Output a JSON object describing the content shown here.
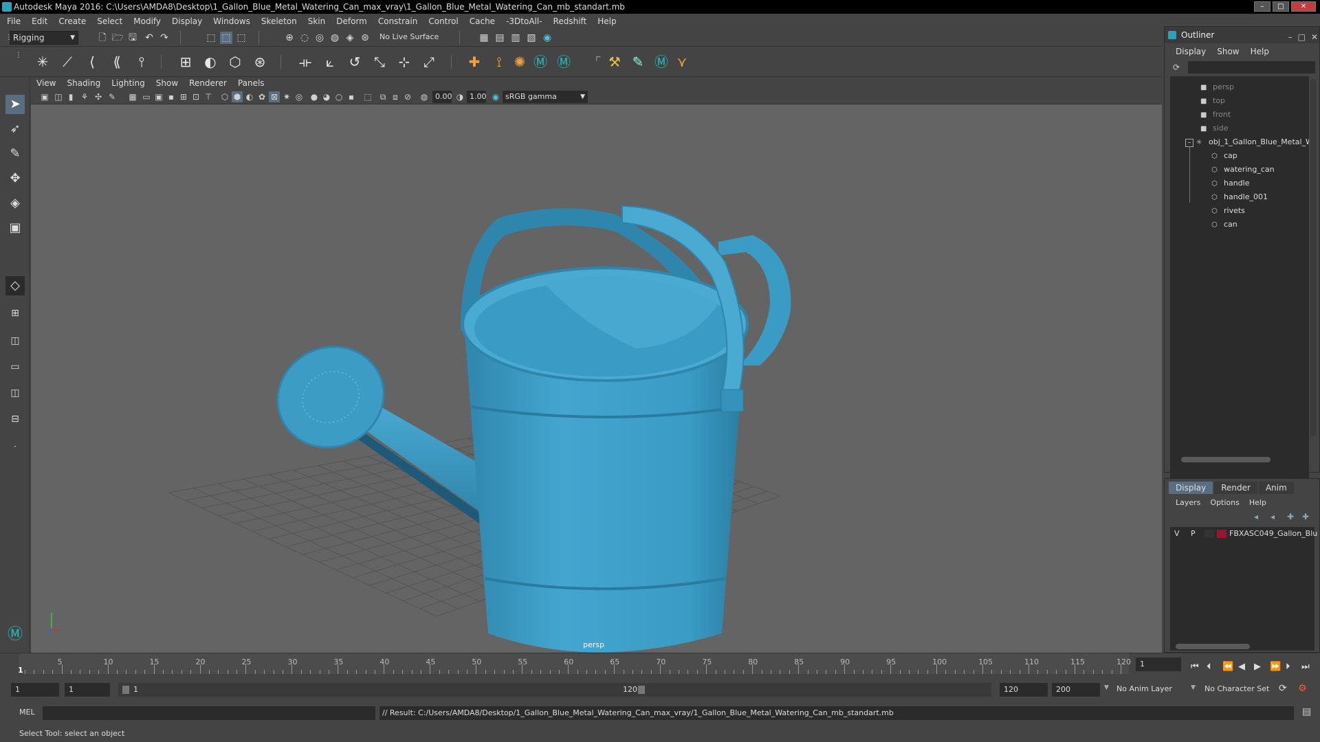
{
  "window": {
    "title": "Autodesk Maya 2016: C:\\Users\\AMDA8\\Desktop\\1_Gallon_Blue_Metal_Watering_Can_max_vray\\1_Gallon_Blue_Metal_Watering_Can_mb_standart.mb",
    "min": "–",
    "max": "□",
    "close": "✕"
  },
  "menu": [
    "File",
    "Edit",
    "Create",
    "Select",
    "Modify",
    "Display",
    "Windows",
    "Skeleton",
    "Skin",
    "Deform",
    "Constrain",
    "Control",
    "Cache",
    "-3DtoAll-",
    "Redshift",
    "Help"
  ],
  "shelf": {
    "mode": "Rigging",
    "live_surface": "No Live Surface"
  },
  "viewport": {
    "menu": [
      "View",
      "Shading",
      "Lighting",
      "Show",
      "Renderer",
      "Panels"
    ],
    "exposure": "0.00",
    "gamma": "1.00",
    "colorspace": "sRGB gamma",
    "camera_label": "persp"
  },
  "outliner": {
    "title": "Outliner",
    "menu": [
      "Display",
      "Show",
      "Help"
    ],
    "cameras": [
      "persp",
      "top",
      "front",
      "side"
    ],
    "group": "obj_1_Gallon_Blue_Metal_W",
    "children": [
      "cap",
      "watering_can",
      "handle",
      "handle_001",
      "rivets",
      "can"
    ]
  },
  "layers": {
    "tabs": [
      "Display",
      "Render",
      "Anim"
    ],
    "menu": [
      "Layers",
      "Options",
      "Help"
    ],
    "row": {
      "v": "V",
      "p": "P",
      "name": "FBXASC049_Gallon_Blu",
      "color": "#a01030"
    }
  },
  "timeline": {
    "ticks": [
      "5",
      "10",
      "15",
      "20",
      "25",
      "30",
      "35",
      "40",
      "45",
      "50",
      "55",
      "60",
      "65",
      "70",
      "75",
      "80",
      "85",
      "90",
      "95",
      "100",
      "105",
      "110",
      "115",
      "120"
    ],
    "current_marker": "1",
    "current_frame": "1"
  },
  "range": {
    "start": "1",
    "playback_start": "1",
    "slider_start": "1",
    "slider_end": "120",
    "playback_end": "120",
    "end": "200",
    "anim_layer": "No Anim Layer",
    "char_set": "No Character Set"
  },
  "command": {
    "lang": "MEL",
    "result": "// Result: C:/Users/AMDA8/Desktop/1_Gallon_Blue_Metal_Watering_Can_max_vray/1_Gallon_Blue_Metal_Watering_Can_mb_standart.mb"
  },
  "help": "Select Tool: select an object",
  "colors": {
    "model": "#3d9cc4",
    "accent": "#2aa3b8"
  }
}
